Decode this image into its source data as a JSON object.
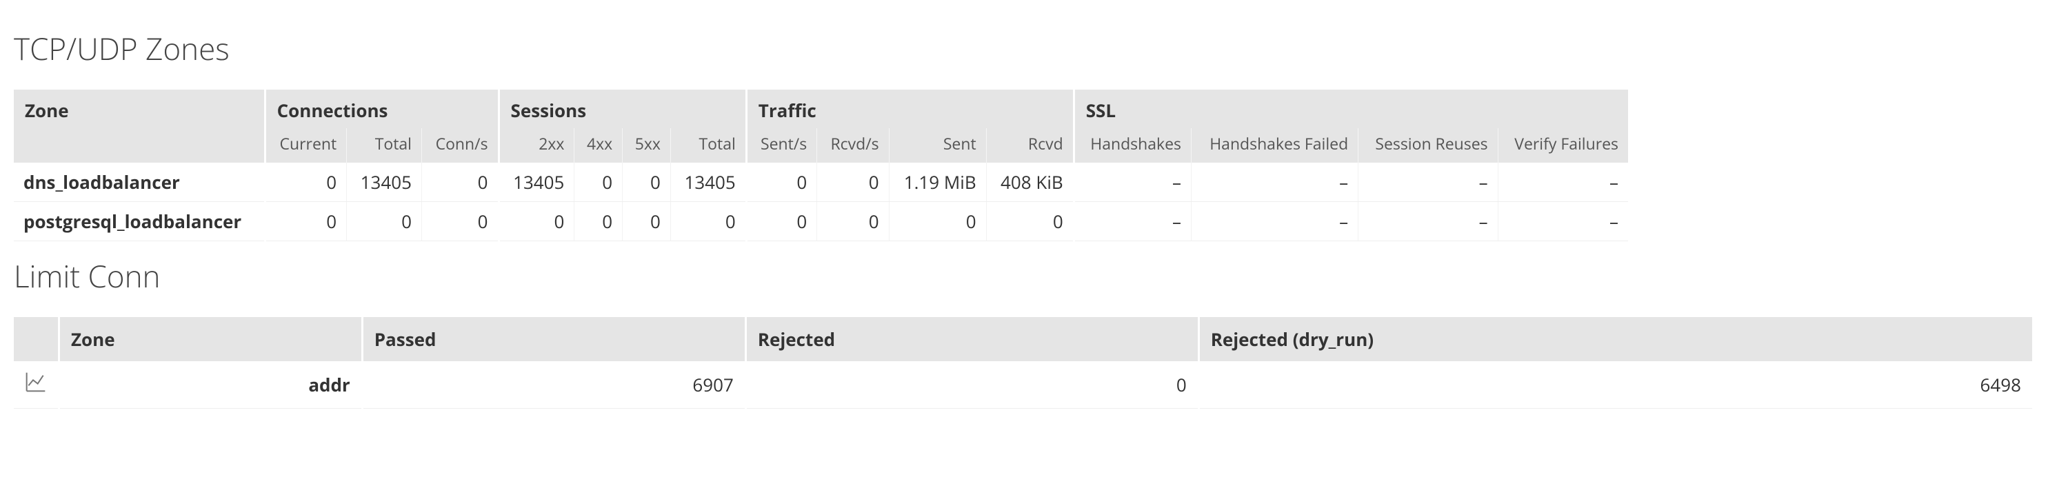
{
  "zones": {
    "title": "TCP/UDP Zones",
    "headers": {
      "zone": "Zone",
      "connections": "Connections",
      "sessions": "Sessions",
      "traffic": "Traffic",
      "ssl": "SSL",
      "sub": {
        "current": "Current",
        "total": "Total",
        "connps": "Conn/s",
        "s2xx": "2xx",
        "s4xx": "4xx",
        "s5xx": "5xx",
        "stotal": "Total",
        "sentps": "Sent/s",
        "rcvdps": "Rcvd/s",
        "sent": "Sent",
        "rcvd": "Rcvd",
        "handshakes": "Handshakes",
        "hfailed": "Handshakes Failed",
        "sreuses": "Session Reuses",
        "vfail": "Verify Failures"
      }
    },
    "rows": [
      {
        "name": "dns_loadbalancer",
        "current": "0",
        "total": "13405",
        "connps": "0",
        "s2xx": "13405",
        "s4xx": "0",
        "s5xx": "0",
        "stotal": "13405",
        "sentps": "0",
        "rcvdps": "0",
        "sent": "1.19 MiB",
        "rcvd": "408 KiB",
        "handshakes": "–",
        "hfailed": "–",
        "sreuses": "–",
        "vfail": "–"
      },
      {
        "name": "postgresql_loadbalancer",
        "current": "0",
        "total": "0",
        "connps": "0",
        "s2xx": "0",
        "s4xx": "0",
        "s5xx": "0",
        "stotal": "0",
        "sentps": "0",
        "rcvdps": "0",
        "sent": "0",
        "rcvd": "0",
        "handshakes": "–",
        "hfailed": "–",
        "sreuses": "–",
        "vfail": "–"
      }
    ]
  },
  "limit": {
    "title": "Limit Conn",
    "headers": {
      "zone": "Zone",
      "passed": "Passed",
      "rejected": "Rejected",
      "rejected_dry": "Rejected (dry_run)"
    },
    "rows": [
      {
        "name": "addr",
        "passed": "6907",
        "rejected": "0",
        "rejected_dry": "6498"
      }
    ]
  }
}
